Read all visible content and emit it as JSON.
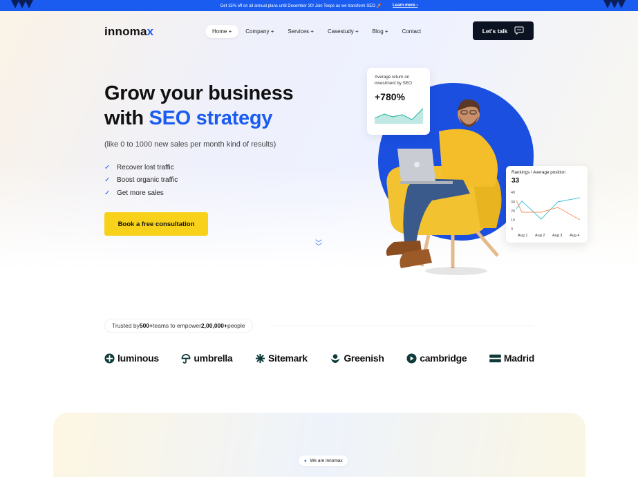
{
  "announcement": {
    "text": "Get 15% off on all annual plans until December 30! Join Teeps as we transform SEO 🚀",
    "link": "Learn more"
  },
  "brand": {
    "logo_main": "innoma",
    "logo_x": "x",
    "accent": "#1a5cf0"
  },
  "nav": {
    "items": [
      {
        "label": "Home +"
      },
      {
        "label": "Company +"
      },
      {
        "label": "Services +"
      },
      {
        "label": "Casestudy +"
      },
      {
        "label": "Blog +"
      },
      {
        "label": "Contact"
      }
    ],
    "cta": "Let's talk"
  },
  "hero": {
    "title_line1": "Grow your business",
    "title_line2_plain": "with ",
    "title_line2_blue": "SEO strategy",
    "subtitle": "(like 0 to 1000 new sales per month kind of results)",
    "checklist": [
      "Recover lost traffic",
      "Boost organic traffic",
      "Get more sales"
    ],
    "cta": "Book a free consultation"
  },
  "stat_card": {
    "label_line1": "Average return on",
    "label_line2": "investment by SEO",
    "value": "+780%"
  },
  "rank_card": {
    "label": "Rankings \\ Average position",
    "value": "33",
    "y_ticks": [
      "40",
      "30",
      "20",
      "10",
      "0"
    ],
    "x_ticks": [
      "Aug 1",
      "Aug 2",
      "Aug 3",
      "Aug 4"
    ]
  },
  "trusted": {
    "prefix": "Trusted by ",
    "teams": "500+",
    "middle": " teams to empower ",
    "people": "2,00,000+",
    "suffix": " people"
  },
  "brands": [
    "luminous",
    "umbrella",
    "Sitemark",
    "Greenish",
    "cambridge",
    "Madrid"
  ],
  "about_pill": "We are innomax"
}
